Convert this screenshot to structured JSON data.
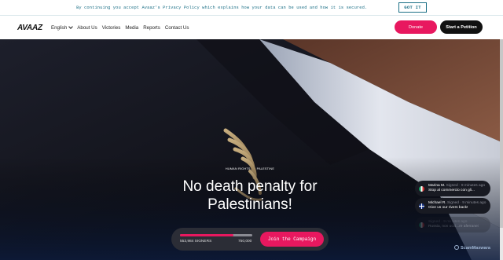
{
  "cookie": {
    "text": "By continuing you accept Avaaz's Privacy Policy which explains how your data can be used and how it is secured.",
    "button": "GOT IT"
  },
  "nav": {
    "logo": "AVAAZ",
    "items": [
      "English",
      "About Us",
      "Victories",
      "Media",
      "Reports",
      "Contact Us"
    ],
    "donate": "Donate",
    "petition": "Start a Petition"
  },
  "hero": {
    "tags": [
      "HUMAN RIGHTS",
      "PALESTINE"
    ],
    "title_line1": "No death penalty for",
    "title_line2": "Palestinians!"
  },
  "campaign": {
    "signers": "553,984 SIGNERS",
    "goal": "750,000",
    "progress": 0.739,
    "join": "Join the Campaign"
  },
  "notifications": [
    {
      "name": "Marina M.",
      "status": "Signed",
      "time": "9 minutes ago",
      "message": "Stop al commercio con gli...",
      "flag": "italy"
    },
    {
      "name": "Michael R.",
      "status": "Signed",
      "time": "9 minutes ago",
      "message": "Give us our rivers back!",
      "flag": "united-kingdom"
    },
    {
      "name": "",
      "status": "Signed",
      "time": "9 minutes ago",
      "message": "Russia, non ucci...re aferranei",
      "flag": "faded"
    }
  ],
  "watermark": "ScamMaxwara",
  "colors": {
    "accent": "#e8185f",
    "cookie_text": "#1b6f86"
  }
}
